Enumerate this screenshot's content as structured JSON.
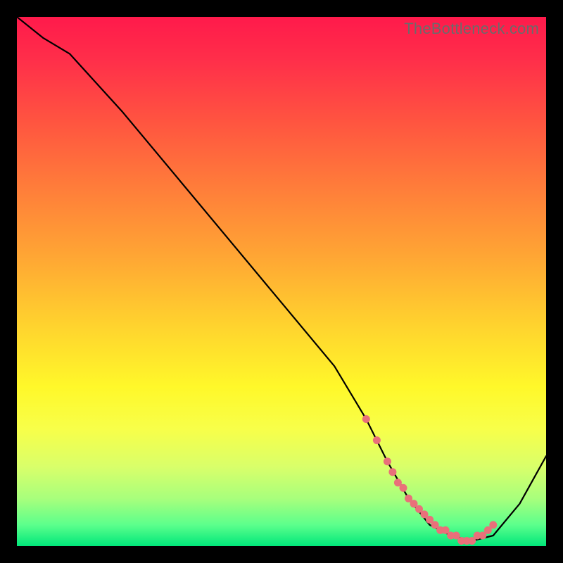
{
  "watermark": "TheBottleneck.com",
  "chart_data": {
    "type": "line",
    "title": "",
    "xlabel": "",
    "ylabel": "",
    "xlim": [
      0,
      100
    ],
    "ylim": [
      0,
      100
    ],
    "series": [
      {
        "name": "curve",
        "x": [
          0,
          5,
          10,
          20,
          30,
          40,
          50,
          60,
          66,
          70,
          74,
          78,
          82,
          86,
          90,
          95,
          100
        ],
        "y": [
          100,
          96,
          93,
          82,
          70,
          58,
          46,
          34,
          24,
          16,
          9,
          4,
          2,
          1,
          2,
          8,
          17
        ]
      }
    ],
    "dots": {
      "name": "low-region-markers",
      "x": [
        66,
        68,
        70,
        71,
        72,
        73,
        74,
        75,
        76,
        77,
        78,
        79,
        80,
        81,
        82,
        83,
        84,
        85,
        86,
        87,
        88,
        89,
        90
      ],
      "y": [
        24,
        20,
        16,
        14,
        12,
        11,
        9,
        8,
        7,
        6,
        5,
        4,
        3,
        3,
        2,
        2,
        1,
        1,
        1,
        2,
        2,
        3,
        4
      ]
    },
    "background_gradient": {
      "top": "#ff1a4b",
      "mid": "#ffd22e",
      "bottom": "#00e77a"
    }
  }
}
